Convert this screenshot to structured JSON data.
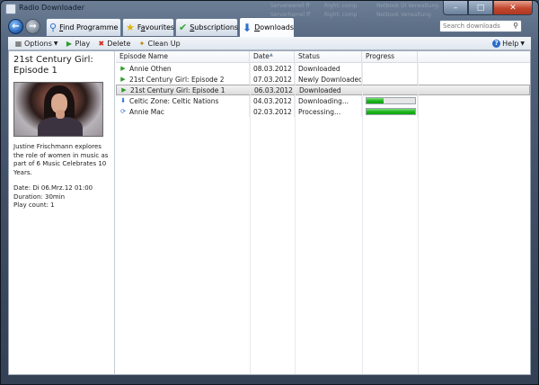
{
  "window": {
    "title": "Radio Downloader",
    "background_text": [
      "Serverwerell ff",
      "Right: comp",
      "Netbook Dl Verwaltung",
      "Serverhamel ff",
      "Right: comp",
      "Netbook Verwaltung"
    ]
  },
  "nav": {
    "tabs": [
      {
        "label": "Find Programme",
        "underline": "F",
        "rest": "ind Programme",
        "icon": "magnifier-icon"
      },
      {
        "label": "Favourites",
        "underline": "a",
        "prefix": "F",
        "rest": "vourites",
        "icon": "star-icon"
      },
      {
        "label": "Subscriptions",
        "underline": "S",
        "rest": "ubscriptions",
        "icon": "check-icon"
      },
      {
        "label": "Downloads",
        "underline": "D",
        "rest": "ownloads",
        "icon": "download-arrow-icon"
      }
    ],
    "active_tab": "Downloads",
    "search_placeholder": "Search downloads"
  },
  "toolbar": {
    "options": "Options",
    "play": "Play",
    "delete": "Delete",
    "cleanup": "Clean Up",
    "help": "Help"
  },
  "detail": {
    "title": "21st Century Girl: Episode 1",
    "description": "Justine Frischmann explores the role of women in music as part of 6 Music Celebrates 10 Years.",
    "date": "Date: Di 06.Mrz.12 01:00",
    "duration": "Duration: 30min",
    "play_count": "Play count: 1"
  },
  "list": {
    "columns": [
      "Episode Name",
      "Date",
      "Status",
      "Progress"
    ],
    "rows": [
      {
        "name": "Annie Othen",
        "date": "08.03.2012",
        "status": "Downloaded",
        "icon": "play-icon",
        "progress": null,
        "selected": false
      },
      {
        "name": "21st Century Girl: Episode 2",
        "date": "07.03.2012",
        "status": "Newly Downloaded",
        "icon": "play-icon",
        "progress": null,
        "selected": false
      },
      {
        "name": "21st Century Girl: Episode 1",
        "date": "06.03.2012",
        "status": "Downloaded",
        "icon": "play-icon",
        "progress": null,
        "selected": true
      },
      {
        "name": "Celtic Zone: Celtic Nations",
        "date": "04.03.2012",
        "status": "Downloading...",
        "icon": "download-arrow-icon",
        "progress": 0.35,
        "selected": false
      },
      {
        "name": "Annie Mac",
        "date": "02.03.2012",
        "status": "Processing...",
        "icon": "processing-icon",
        "progress": 1.0,
        "selected": false
      }
    ]
  },
  "colors": {
    "accent": "#2e6fcf",
    "progress_green": "#19b219",
    "play_green": "#2d9b2d"
  }
}
